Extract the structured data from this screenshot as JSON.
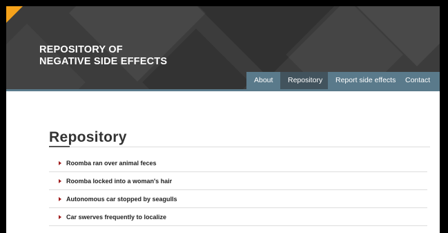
{
  "header": {
    "title_line1": "REPOSITORY OF",
    "title_line2": "NEGATIVE SIDE EFFECTS",
    "accent_color": "#f5a21b"
  },
  "nav": {
    "items": [
      {
        "label": "About"
      },
      {
        "label": "Repository"
      },
      {
        "label": "Report side effects"
      },
      {
        "label": "Contact"
      }
    ],
    "active": "Repository",
    "color": "#5a7a8b",
    "active_color": "#42535d"
  },
  "main": {
    "heading": "Repository",
    "items": [
      {
        "label": "Roomba ran over animal feces"
      },
      {
        "label": "Roomba locked into a woman's hair"
      },
      {
        "label": "Autonomous car stopped by seagulls"
      },
      {
        "label": "Car swerves frequently to localize"
      }
    ],
    "bullet_color": "#a01c1c",
    "bullet_icon": "caret-right-icon"
  }
}
